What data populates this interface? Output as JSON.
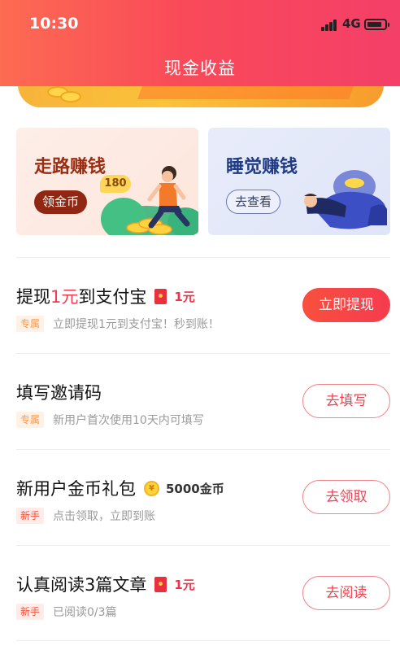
{
  "status_bar": {
    "time": "10:30",
    "network": "4G"
  },
  "header": {
    "title": "现金收益"
  },
  "cards": [
    {
      "title": "走路赚钱",
      "action": "领金币",
      "badge": "180"
    },
    {
      "title": "睡觉赚钱",
      "action": "去查看"
    }
  ],
  "tasks": [
    {
      "title_prefix": "提现",
      "title_highlight": "1元",
      "title_suffix": "到支付宝",
      "reward": "1元",
      "tag": "专属",
      "desc": "立即提现1元到支付宝！秒到账！",
      "button": "立即提现"
    },
    {
      "title": "填写邀请码",
      "tag": "专属",
      "desc": "新用户首次使用10天内可填写",
      "button": "去填写"
    },
    {
      "title": "新用户金币礼包",
      "reward": "5000金币",
      "tag": "新手",
      "desc": "点击领取，立即到账",
      "button": "去领取"
    },
    {
      "title": "认真阅读3篇文章",
      "reward": "1元",
      "tag": "新手",
      "desc": "已阅读0/3篇",
      "button": "去阅读"
    }
  ],
  "colors": {
    "header_gradient_start": "#fd6b52",
    "header_gradient_end": "#f43f68",
    "accent_red": "#f23d4f",
    "walk_title": "#9c2d12",
    "sleep_title": "#1f3b85"
  }
}
